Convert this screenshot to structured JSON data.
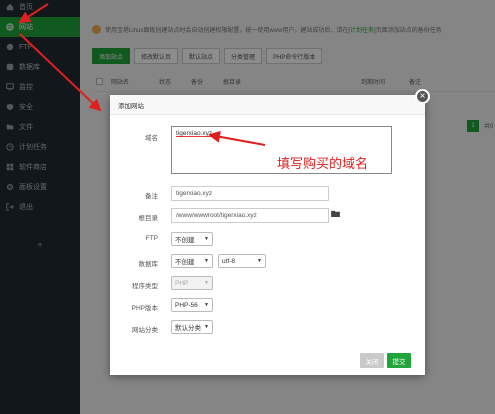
{
  "sidebar": {
    "items": [
      {
        "label": "首页",
        "icon": "home-icon",
        "active": false
      },
      {
        "label": "网站",
        "icon": "globe-icon",
        "active": true
      },
      {
        "label": "FTP",
        "icon": "ftp-icon",
        "active": false
      },
      {
        "label": "数据库",
        "icon": "database-icon",
        "active": false
      },
      {
        "label": "监控",
        "icon": "monitor-icon",
        "active": false
      },
      {
        "label": "安全",
        "icon": "shield-icon",
        "active": false
      },
      {
        "label": "文件",
        "icon": "folder-icon",
        "active": false
      },
      {
        "label": "计划任务",
        "icon": "clock-icon",
        "active": false
      },
      {
        "label": "软件商店",
        "icon": "store-icon",
        "active": false
      },
      {
        "label": "面板设置",
        "icon": "gear-icon",
        "active": false
      },
      {
        "label": "退出",
        "icon": "logout-icon",
        "active": false
      }
    ],
    "plus": "+"
  },
  "main": {
    "notice_prefix": "使用宝塔Linux面板创建站点时会自动创建权限配置，统一使用www用户。建站成功后，请在",
    "notice_link": "[计划任务]",
    "notice_suffix": "页面添加站点的备份任务",
    "toolbar": [
      "添加站点",
      "修改默认页",
      "默认站点",
      "分类管理",
      "PHP命令行版本"
    ],
    "table_headers": [
      "网站名",
      "状态",
      "备份",
      "根目录",
      "到期时间",
      "备注"
    ],
    "pager_page": "1",
    "pager_text": "共0"
  },
  "modal": {
    "title": "添加网站",
    "domain_label": "域名",
    "domain_value": "tigerxiao.xyz",
    "remark_label": "备注",
    "remark_value": "tigerxiao.xyz",
    "root_label": "根目录",
    "root_value": "/www/wwwroot/tigerxiao.xyz",
    "ftp_label": "FTP",
    "ftp_value": "不创建",
    "db_label": "数据库",
    "db_value": "不创建",
    "db_charset": "utf-8",
    "prog_label": "程序类型",
    "prog_value": "PHP",
    "php_label": "PHP版本",
    "php_value": "PHP-56",
    "cat_label": "网站分类",
    "cat_value": "默认分类",
    "cancel": "关闭",
    "submit": "提交",
    "close": "×"
  },
  "annotation": "填写购买的域名",
  "colors": {
    "accent": "#20a53a",
    "sidebar_bg": "#222a32",
    "annotation": "#e01f1f"
  }
}
